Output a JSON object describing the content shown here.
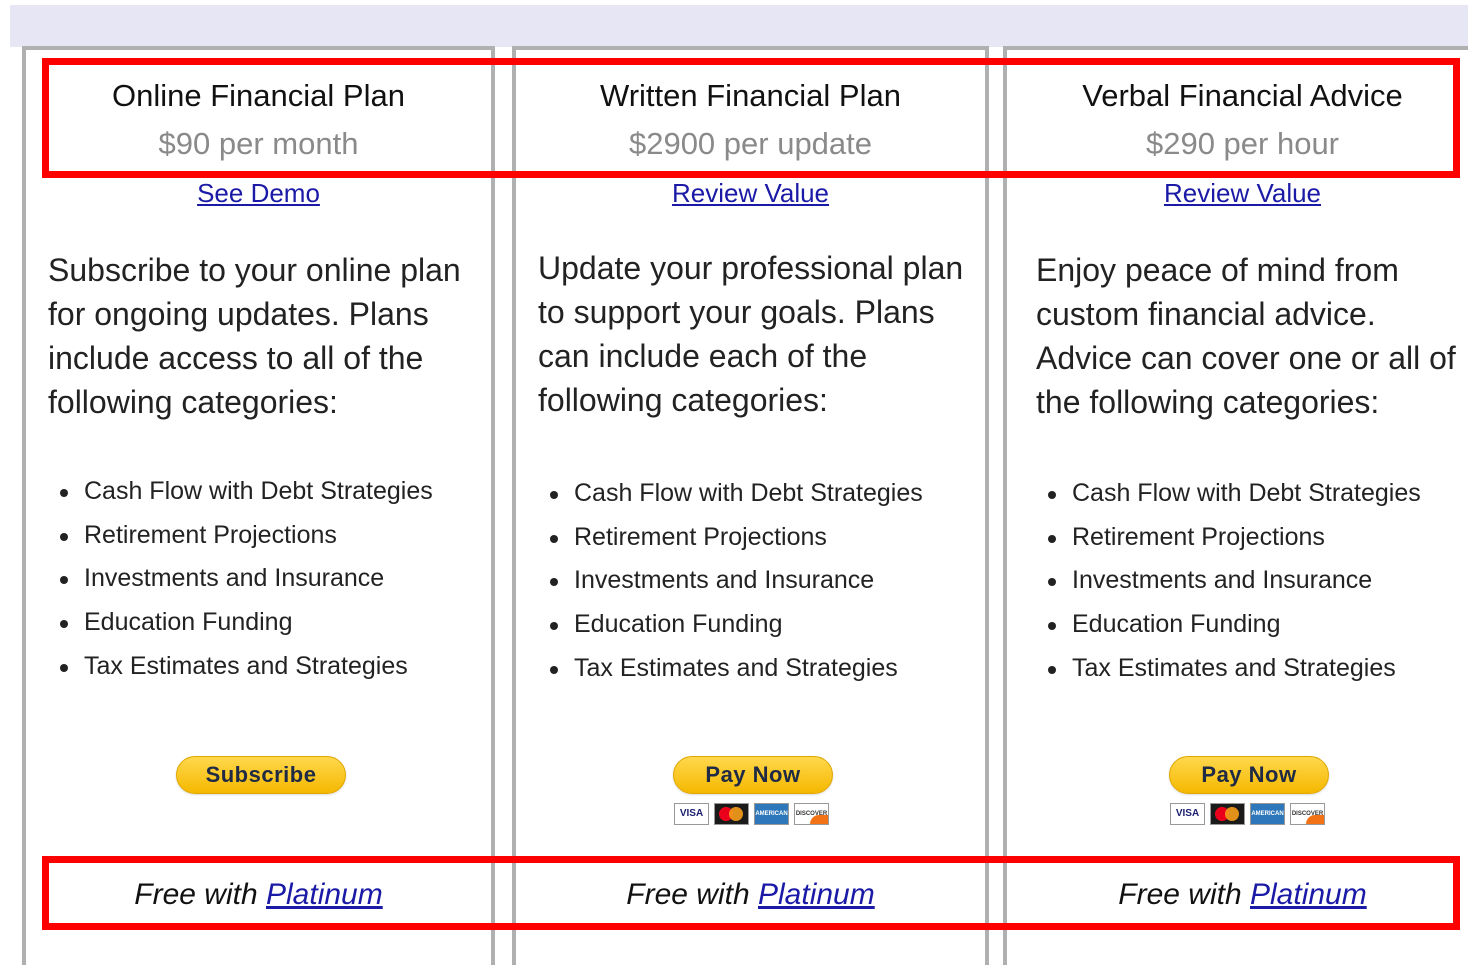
{
  "plans": [
    {
      "title": "Online Financial Plan",
      "price": "$90 per month",
      "link": "See Demo",
      "description": "Subscribe to your online plan for ongoing updates. Plans include access to all of the following categories:",
      "features": [
        "Cash Flow with Debt Strategies",
        "Retirement Projections",
        "Investments and Insurance",
        "Education Funding",
        "Tax Estimates and Strategies"
      ],
      "button": "Subscribe",
      "free_text": "Free with ",
      "free_link": "Platinum"
    },
    {
      "title": "Written Financial Plan",
      "price": "$2900 per update",
      "link": "Review Value",
      "description": "Update your professional plan to support your goals. Plans can include each of the following categories:",
      "features": [
        "Cash Flow with Debt Strategies",
        "Retirement Projections",
        "Investments and Insurance",
        "Education Funding",
        "Tax Estimates and Strategies"
      ],
      "button": "Pay Now",
      "free_text": "Free with ",
      "free_link": "Platinum"
    },
    {
      "title": "Verbal Financial Advice",
      "price": "$290 per hour",
      "link": "Review Value",
      "description": "Enjoy peace of mind from custom financial advice. Advice can cover one or all of the following categories:",
      "features": [
        "Cash Flow with Debt Strategies",
        "Retirement Projections",
        "Investments and Insurance",
        "Education Funding",
        "Tax Estimates and Strategies"
      ],
      "button": "Pay Now",
      "free_text": "Free with ",
      "free_link": "Platinum"
    }
  ],
  "payment_cards": {
    "visa": "VISA",
    "amex": "AMERICAN EXPRESS",
    "discover": "DISCOVER"
  },
  "colors": {
    "link": "#1a1aa6",
    "price": "#8a8a8a",
    "button": "#ffc439",
    "highlight": "#ff0000",
    "card_border": "#b0b0b0",
    "header_band": "#e6e6f5"
  }
}
